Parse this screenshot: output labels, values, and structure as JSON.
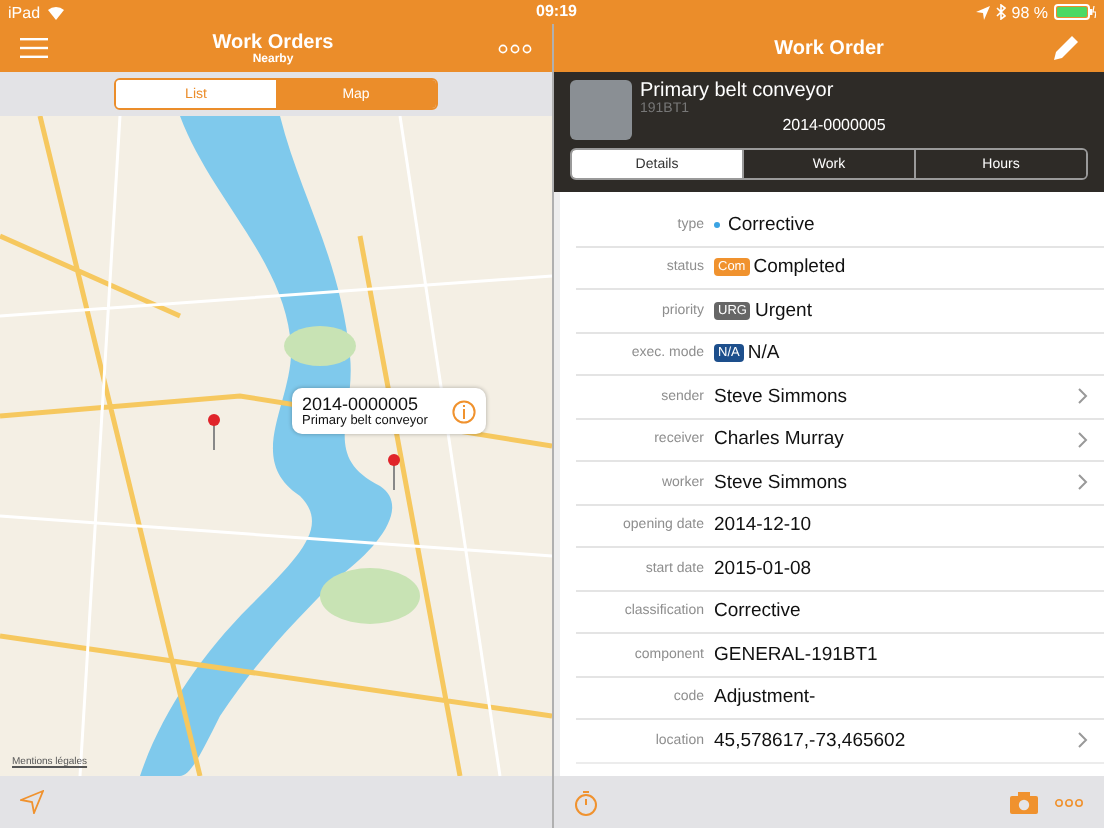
{
  "status_bar": {
    "device": "iPad",
    "time": "09:19",
    "battery": "98 %"
  },
  "list_pane": {
    "title": "Work Orders",
    "subtitle": "Nearby",
    "segments": [
      {
        "label": "List",
        "selected": false
      },
      {
        "label": "Map",
        "selected": true
      }
    ],
    "map": {
      "callout": {
        "number": "2014-0000005",
        "name": "Primary belt conveyor"
      },
      "legal_link": "Mentions légales"
    }
  },
  "detail_pane": {
    "title": "Work Order",
    "asset": {
      "name": "Primary belt conveyor",
      "code": "191BT1",
      "number": "2014-0000005"
    },
    "tabs": [
      {
        "label": "Details",
        "selected": true
      },
      {
        "label": "Work",
        "selected": false
      },
      {
        "label": "Hours",
        "selected": false
      }
    ],
    "fields": [
      {
        "label": "type",
        "kind": "dot",
        "color": "#3aa3e3",
        "value": "Corrective",
        "disclosure": false
      },
      {
        "label": "status",
        "kind": "badge",
        "badge": "Com",
        "color": "#f0922e",
        "value": "Completed",
        "disclosure": false
      },
      {
        "label": "priority",
        "kind": "badge",
        "badge": "URG",
        "color": "#666666",
        "value": "Urgent",
        "disclosure": false
      },
      {
        "label": "exec. mode",
        "kind": "badge",
        "badge": "N/A",
        "color": "#1d4f8c",
        "value": "N/A",
        "disclosure": false
      },
      {
        "label": "sender",
        "kind": "text",
        "value": "Steve Simmons",
        "disclosure": true
      },
      {
        "label": "receiver",
        "kind": "text",
        "value": "Charles Murray",
        "disclosure": true
      },
      {
        "label": "worker",
        "kind": "text",
        "value": "Steve Simmons",
        "disclosure": true
      },
      {
        "label": "opening date",
        "kind": "text",
        "value": "2014-12-10",
        "disclosure": false
      },
      {
        "label": "start date",
        "kind": "text",
        "value": "2015-01-08",
        "disclosure": false
      },
      {
        "label": "classification",
        "kind": "text",
        "value": "Corrective",
        "disclosure": false
      },
      {
        "label": "component",
        "kind": "text",
        "value": "GENERAL-191BT1",
        "disclosure": false
      },
      {
        "label": "code",
        "kind": "text",
        "value": "Adjustment-",
        "disclosure": false
      },
      {
        "label": "location",
        "kind": "text",
        "value": "45,578617,-73,465602",
        "disclosure": true
      }
    ]
  }
}
